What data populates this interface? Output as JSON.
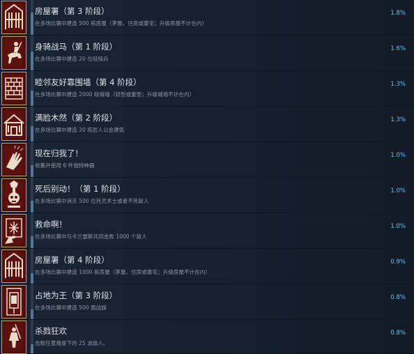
{
  "achievements": [
    {
      "title": "房屋署（第 3 阶段）",
      "desc": "在多场比赛中建造 500 栋房屋（茅屋、住房或豪宅；升级房屋不计在内）",
      "pct": "1.8%",
      "icon": "house-icon"
    },
    {
      "title": "身骑战马（第 1 阶段）",
      "desc": "在多场比赛中建造 20 位轻骑兵",
      "pct": "1.6%",
      "icon": "knight-rider-icon"
    },
    {
      "title": "睦邻友好靠围墙（第 4 阶段）",
      "desc": "在多场比赛中建造 2000 段城墙（轻型或重型；升级城墙不计在内）",
      "pct": "1.3%",
      "icon": "brick-wall-icon"
    },
    {
      "title": "满脸木然（第 2 阶段）",
      "desc": "在多场比赛中建造 20 栋匠人公会建筑",
      "pct": "1.3%",
      "icon": "guild-building-icon"
    },
    {
      "title": "现在归我了！",
      "desc": "收集并使用 6 件独特神器",
      "pct": "1.0%",
      "icon": "grabbing-hand-icon"
    },
    {
      "title": "死后别动！（第 1 阶段）",
      "desc": "在多场比赛中消灭 500 位死灵术士或者不死敌人",
      "pct": "1.0%",
      "icon": "skull-totem-icon"
    },
    {
      "title": "救命啊！",
      "desc": "在多场比赛中与卡兰瑟斯共同击败 1000 个敌人",
      "pct": "1.0%",
      "icon": "hand-rune-icon"
    },
    {
      "title": "房屋署（第 4 阶段）",
      "desc": "在多场比赛中建造 1000 栋房屋（茅屋、住房或豪宅；升级房屋不计在内）",
      "pct": "0.9%",
      "icon": "house-icon"
    },
    {
      "title": "占地为王（第 3 阶段）",
      "desc": "在多场比赛中建造 500 面战旗",
      "pct": "0.8%",
      "icon": "war-banner-icon"
    },
    {
      "title": "杀戮狂欢",
      "desc": "击败任意难度下的 25 波敌人。",
      "pct": "0.8%",
      "icon": "warrior-icon"
    }
  ],
  "fill_fractions": [
    0.65,
    0.55,
    0.45,
    0.45,
    0.35,
    0.35,
    0.35,
    0.3,
    0.28,
    0.28
  ],
  "colors": {
    "percent": "#66c0f4",
    "title": "#dfe3e6",
    "desc": "#8f98a0",
    "icon_bg": "#5e1210"
  }
}
